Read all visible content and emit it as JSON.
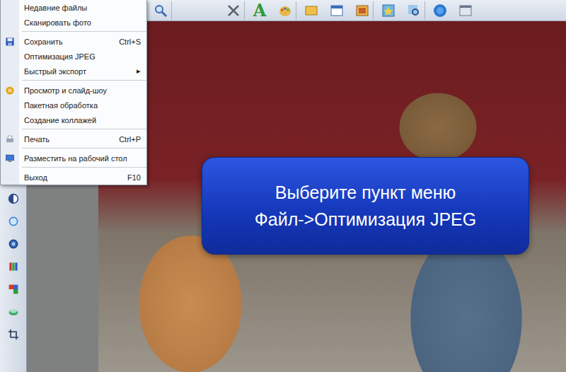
{
  "window": {
    "app": "photo-editor"
  },
  "toolbar": {
    "text_tool_glyph": "A"
  },
  "file_menu": {
    "open": true,
    "items": [
      {
        "kind": "item",
        "label": "Недавние файлы",
        "shortcut": "",
        "submenu": "",
        "selected": false
      },
      {
        "kind": "item",
        "label": "Сканировать фото",
        "shortcut": "",
        "submenu": "",
        "selected": false
      },
      {
        "kind": "separator"
      },
      {
        "kind": "item",
        "label": "Сохранить",
        "shortcut": "Ctrl+S",
        "submenu": "",
        "selected": false
      },
      {
        "kind": "item",
        "label": "Оптимизация JPEG",
        "shortcut": "",
        "submenu": "",
        "selected": false
      },
      {
        "kind": "item",
        "label": "Быстрый экспорт",
        "shortcut": "",
        "submenu": "▸",
        "selected": false
      },
      {
        "kind": "separator"
      },
      {
        "kind": "item",
        "label": "Просмотр и слайд-шоу",
        "shortcut": "",
        "submenu": "",
        "selected": false
      },
      {
        "kind": "item",
        "label": "Пакетная обработка",
        "shortcut": "",
        "submenu": "",
        "selected": false
      },
      {
        "kind": "item",
        "label": "Создание коллажей",
        "shortcut": "",
        "submenu": "",
        "selected": false
      },
      {
        "kind": "separator"
      },
      {
        "kind": "item",
        "label": "Печать",
        "shortcut": "Ctrl+P",
        "submenu": "",
        "selected": false
      },
      {
        "kind": "separator"
      },
      {
        "kind": "item",
        "label": "Разместить на рабочий стол",
        "shortcut": "",
        "submenu": "",
        "selected": false
      },
      {
        "kind": "separator"
      },
      {
        "kind": "item",
        "label": "Выход",
        "shortcut": "F10",
        "submenu": "",
        "selected": false
      }
    ]
  },
  "callout": {
    "lines": [
      "Выберите пункт меню",
      "Файл->Оптимизация JPEG"
    ]
  }
}
